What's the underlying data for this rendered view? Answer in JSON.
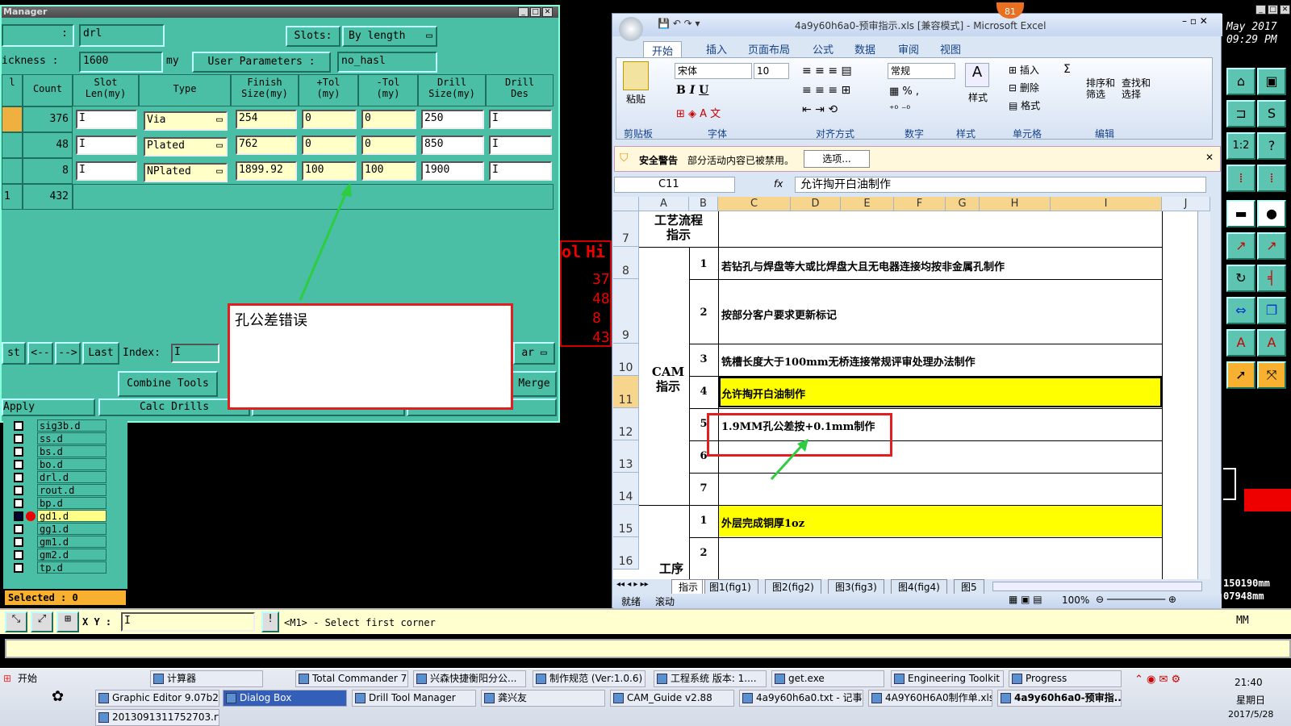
{
  "drill_manager": {
    "title": "Manager",
    "drill_field": "drl",
    "slots_label": "Slots:",
    "slots_value": "By length",
    "thickness_label": "ickness :",
    "thickness_value": "1600",
    "thickness_unit": "my",
    "user_params_label": "User Parameters :",
    "user_params_value": "no_hasl",
    "colon": ":",
    "headers": [
      "l",
      "Count",
      "Slot\nLen(my)",
      "Type",
      "Finish\nSize(my)",
      "+Tol\n(my)",
      "-Tol\n(my)",
      "Drill\nSize(my)",
      "Drill\nDes"
    ],
    "rows": [
      {
        "count": "376",
        "type": "Via",
        "finish": "254",
        "ptol": "0",
        "mtol": "0",
        "drill": "250"
      },
      {
        "count": "48",
        "type": "Plated",
        "finish": "762",
        "ptol": "0",
        "mtol": "0",
        "drill": "850"
      },
      {
        "count": "8",
        "type": "NPlated",
        "finish": "1899.92",
        "ptol": "100",
        "mtol": "100",
        "drill": "1900"
      }
    ],
    "total_idx": "1",
    "total_count": "432",
    "nav": {
      "first": "st",
      "prev": "<--",
      "next": "-->",
      "last": "Last",
      "index": "Index:"
    },
    "btn_ar": "ar",
    "btn_combine": "Combine Tools",
    "btn_merge": "Merge",
    "btn_apply": "Apply",
    "btn_calc": "Calc Drills"
  },
  "annotation1": {
    "text": "孔公差错误"
  },
  "layers": {
    "items": [
      {
        "name": "sig3b.d"
      },
      {
        "name": "ss.d"
      },
      {
        "name": "bs.d"
      },
      {
        "name": "bo.d"
      },
      {
        "name": "drl.d"
      },
      {
        "name": "rout.d"
      },
      {
        "name": "bp.d"
      },
      {
        "name": "gd1.d"
      },
      {
        "name": "gg1.d"
      },
      {
        "name": "gm1.d"
      },
      {
        "name": "gm2.d"
      },
      {
        "name": "tp.d"
      }
    ],
    "selected": "Selected : 0"
  },
  "bottom_bar": {
    "xy_label": "X Y :",
    "status": "<M1> - Select first corner",
    "unit": "MM"
  },
  "red_table": {
    "h1": "ol",
    "h2": "Hi",
    "vals": [
      "37",
      "48",
      "8",
      "43"
    ]
  },
  "excel": {
    "title": "4a9y60h6a0-预审指示.xls  [兼容模式] - Microsoft Excel",
    "badge": "81",
    "tabs": [
      "开始",
      "插入",
      "页面布局",
      "公式",
      "数据",
      "审阅",
      "视图"
    ],
    "groups": [
      "剪贴板",
      "字体",
      "对齐方式",
      "数字",
      "样式",
      "单元格",
      "编辑"
    ],
    "font_name": "宋体",
    "font_size": "10",
    "number_format": "常规",
    "paste": "粘贴",
    "style": "样式",
    "insert": "插入",
    "delete": "删除",
    "format": "格式",
    "sort": "排序和\n筛选",
    "find": "查找和\n选择",
    "security_label": "安全警告",
    "security_text": "部分活动内容已被禁用。",
    "options_btn": "选项...",
    "namebox": "C11",
    "fx": "fx",
    "formula": "允许掏开白油制作",
    "columns": [
      "A",
      "B",
      "C",
      "D",
      "E",
      "F",
      "G",
      "H",
      "I",
      "J"
    ],
    "rows": [
      {
        "r": "7",
        "b": "",
        "c": ""
      },
      {
        "r": "8",
        "b": "1",
        "c": "若钻孔与焊盘等大或比焊盘大且无电器连接均按非金属孔制作"
      },
      {
        "r": "9",
        "b": "2",
        "c": "按部分客户要求更新标记"
      },
      {
        "r": "10",
        "b": "3",
        "c": "铣槽长度大于100mm无桥连接常规评审处理办法制作"
      },
      {
        "r": "11",
        "b": "4",
        "c": "允许掏开白油制作"
      },
      {
        "r": "12",
        "b": "5",
        "c": "1.9MM孔公差按+0.1mm制作"
      },
      {
        "r": "13",
        "b": "6",
        "c": ""
      },
      {
        "r": "14",
        "b": "7",
        "c": ""
      },
      {
        "r": "15",
        "b": "1",
        "c": "外层完成铜厚1oz"
      },
      {
        "r": "16",
        "b": "2",
        "c": ""
      }
    ],
    "a_labels": {
      "process": "工艺流程\n指示",
      "cam": "CAM\n指示",
      "work": "工序"
    },
    "sheet_tabs": [
      "指示",
      "图1(fig1)",
      "图2(fig2)",
      "图3(fig3)",
      "图4(fig4)",
      "图5"
    ],
    "status_ready": "就绪",
    "status_scroll": "滚动",
    "zoom": "100%"
  },
  "right_panel": {
    "date": "May 2017",
    "time": "09:29 PM",
    "coord1": "150190mm",
    "coord2": "07948mm"
  },
  "taskbar": {
    "start": "开始",
    "row1": [
      "Graphic Editor 9.07b2 (0...",
      "Dialog Box",
      "Drill Tool Manager",
      "龚兴友",
      "CAM_Guide v2.88",
      "4a9y60h6a0.txt - 记事本",
      "4A9Y60H6A0制作单.xls...",
      "4a9y60h6a0-预审指..."
    ],
    "row0": [
      "计算器",
      "Total Commander 7.0...",
      "兴森快捷衡阳分公...",
      "制作规范 (Ver:1.0.6)",
      "工程系统  版本: 1....",
      "get.exe",
      "Engineering Toolkit 9....",
      "Progress"
    ],
    "row2": [
      "2013091311752703.rtf..."
    ],
    "clock": "21:40",
    "weekday": "星期日",
    "date": "2017/5/28"
  }
}
